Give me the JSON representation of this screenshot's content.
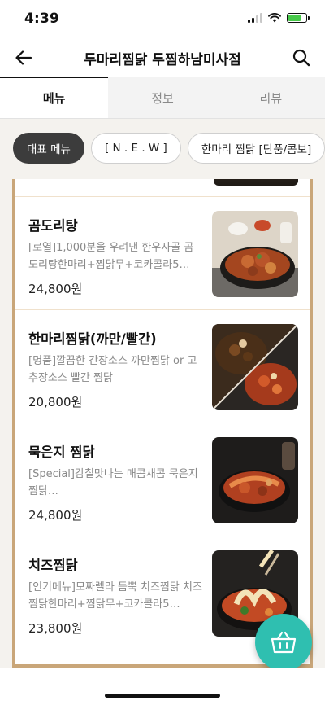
{
  "status_bar": {
    "time": "4:39"
  },
  "header": {
    "title": "두마리찜닭 두찜하남미사점"
  },
  "tabs": [
    {
      "label": "메뉴",
      "active": true
    },
    {
      "label": "정보",
      "active": false
    },
    {
      "label": "리뷰",
      "active": false
    }
  ],
  "chips": [
    {
      "label": "대표 메뉴",
      "active": true
    },
    {
      "label": "[ N . E . W ]",
      "active": false
    },
    {
      "label": "한마리 찜닭 [단품/콤보]",
      "active": false
    }
  ],
  "menu_items": [
    {
      "name": "곰도리탕",
      "desc": "[로열]1,000분을 우려낸 한우사골 곰도리탕한마리+찜닭무+코카콜라5…",
      "price": "24,800원"
    },
    {
      "name": "한마리찜닭(까만/빨간)",
      "desc": "[명품]깔끔한 간장소스 까만찜닭 or 고추장소스 빨간 찜닭",
      "price": "20,800원"
    },
    {
      "name": "묵은지 찜닭",
      "desc": "[Special]감칠맛나는 매콤새콤 묵은지 찜닭…",
      "price": "24,800원"
    },
    {
      "name": "치즈찜닭",
      "desc": "[인기메뉴]모짜렐라 듬뿍 치즈찜닭 치즈찜닭한마리+찜닭무+코카콜라5…",
      "price": "23,800원"
    }
  ],
  "colors": {
    "accent_teal": "#2fbfb0",
    "panel_border": "#c9a679",
    "chip_active": "#3c3c3c"
  },
  "icons": {
    "back": "arrow-left-icon",
    "search": "search-icon",
    "cart": "basket-icon"
  }
}
